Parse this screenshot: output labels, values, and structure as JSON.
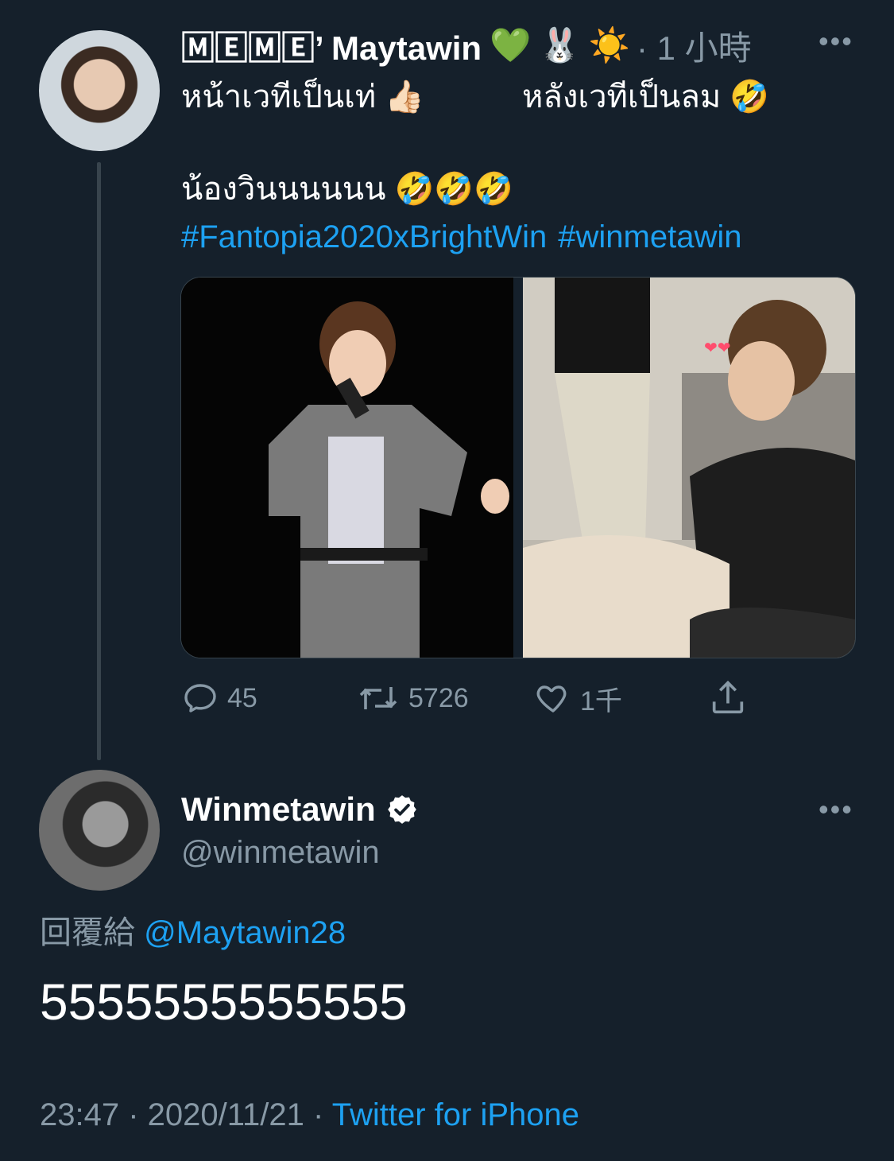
{
  "parent_tweet": {
    "display_name": "🄼🄴🄼🄴’ Maytawin",
    "name_emojis": [
      "💚",
      "🐰",
      "☀️"
    ],
    "time": "· 1 小時",
    "text_line1_left": "หน้าเวทีเป็นเท่ 👍🏻",
    "text_line1_right": "หลังเวทีเป็นลม 🤣",
    "text_line2": "น้องวินนนนนน 🤣🤣🤣",
    "hashtags": [
      "#Fantopia2020xBrightWin",
      "#winmetawin"
    ],
    "reply_count": "45",
    "retweet_count": "5726",
    "like_count": "1千"
  },
  "reply_tweet": {
    "display_name": "Winmetawin",
    "handle": "@winmetawin",
    "reply_to_label": "回覆給",
    "reply_to_handle": "@Maytawin28",
    "text": "5555555555555",
    "time": "23:47",
    "date": "2020/11/21",
    "source": "Twitter for iPhone"
  },
  "colors": {
    "background": "#15202b",
    "link": "#1da1f2",
    "secondary_text": "#8899a6"
  },
  "icons": [
    "more-icon",
    "reply-icon",
    "retweet-icon",
    "like-icon",
    "share-icon",
    "verified-icon"
  ]
}
